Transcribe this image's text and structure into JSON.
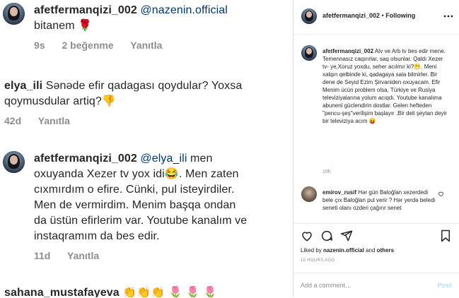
{
  "left": {
    "comments": [
      {
        "user": "afetfermanqizi_002",
        "mention": "@nazenin.official",
        "lines": [
          "bitanem"
        ],
        "emoji": "🌹",
        "time": "9s",
        "likes": "2 beğenme",
        "reply": "Yanıtla"
      },
      {
        "user": "elya_ili",
        "line1": "Sənəde efir qadagası qoydular? Yoxsa",
        "line2": "qoymusdular artiq?",
        "emoji": "👎",
        "time": "42d",
        "reply": "Yanıtla"
      },
      {
        "user": "afetfermanqizi_002",
        "mention": "@elya_ili",
        "line1_rest": "men",
        "line2a": "oxuyanda Xezer tv yox idi",
        "emoji": "😂",
        "line2b": ". Men zaten",
        "line3": "cıxmırdım o efire. Cünki, pul isteyirdiler.",
        "line4": "Men de vermirdim. Menim başqa ondan",
        "line5": "da üstün efirlerim var. Youtube kanalım ve",
        "line6": "instaqramım da bes edir.",
        "time": "11d",
        "reply": "Yanıtla"
      },
      {
        "user": "sahana_mustafayeva",
        "emoji": "👏👏👏 🌷 🌷 🌷"
      }
    ]
  },
  "right": {
    "header_user": "afetfermanqizi_002",
    "header_sep": " • ",
    "header_follow": "Following",
    "caption_user": "afetfermanqizi_002",
    "caption": "Atv ve Arb tv bes edir mene. Temennasız caqırırlar, saq olsunlar. Qaldı Xezer tv- ye,Xoruz yoxdu, seher acılmır ki?😁. Meni xalqın qelbinde ki, qadagaya sala bilmirler. Bir dene de Seyid Ezim Şirvaniden oxuyacam. Efir Menim ücün problem olsa, Türkiye ve Rusiya televiziyalarına yolum acıqdı. Youtube kanalıma abuneni güclendirin dostlar. Gelen hefteden \"pencu-şeş\"verilişim başlayır .Bir deli şeytan deyir bir televiziya acım 😝",
    "caption_time": "10h",
    "comment_user": "emirov_rusif",
    "comment_text": "Hər gün Baloğlan xezerdedi bele çıx Baloğlan pul verir ? Hər yerdə beledi seneti olanı ozderi çağırır senet",
    "liked_prefix": "Liked by ",
    "liked_user": "nazenin.official",
    "liked_mid": " and ",
    "liked_others": "others",
    "post_age": "10 HOURS AGO",
    "add_comment_placeholder": "Add a comment…",
    "post_button": "Post"
  }
}
